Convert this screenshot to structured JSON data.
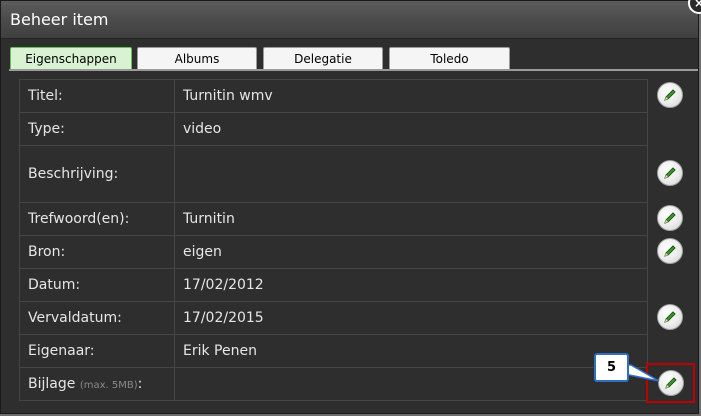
{
  "window": {
    "title": "Beheer item",
    "close_symbol": "×"
  },
  "tabs": [
    {
      "label": "Eigenschappen",
      "active": true
    },
    {
      "label": "Albums",
      "active": false
    },
    {
      "label": "Delegatie",
      "active": false
    },
    {
      "label": "Toledo",
      "active": false
    }
  ],
  "properties": [
    {
      "label": "Titel:",
      "value": "Turnitin wmv",
      "editable": true
    },
    {
      "label": "Type:",
      "value": "video",
      "editable": false
    },
    {
      "label": "Beschrijving:",
      "value": "",
      "editable": true
    },
    {
      "label": "Trefwoord(en):",
      "value": "Turnitin",
      "editable": true
    },
    {
      "label": "Bron:",
      "value": "eigen",
      "editable": true
    },
    {
      "label": "Datum:",
      "value": "17/02/2012",
      "editable": false
    },
    {
      "label": "Vervaldatum:",
      "value": "17/02/2015",
      "editable": true
    },
    {
      "label": "Eigenaar:",
      "value": "Erik Penen",
      "editable": false
    },
    {
      "label": "Bijlage",
      "hint": "(max. 5MB)",
      "suffix": ":",
      "value": "",
      "editable": true
    }
  ],
  "callout": {
    "number": "5"
  },
  "colors": {
    "dialog_bg": "#2e2e2e",
    "active_tab": "#d8f2d2",
    "pencil_green": "#3c9a2c",
    "highlight_red": "#c00000",
    "callout_blue": "#2f6fc4"
  },
  "icons": {
    "edit": "pencil-icon",
    "close": "close-icon"
  }
}
